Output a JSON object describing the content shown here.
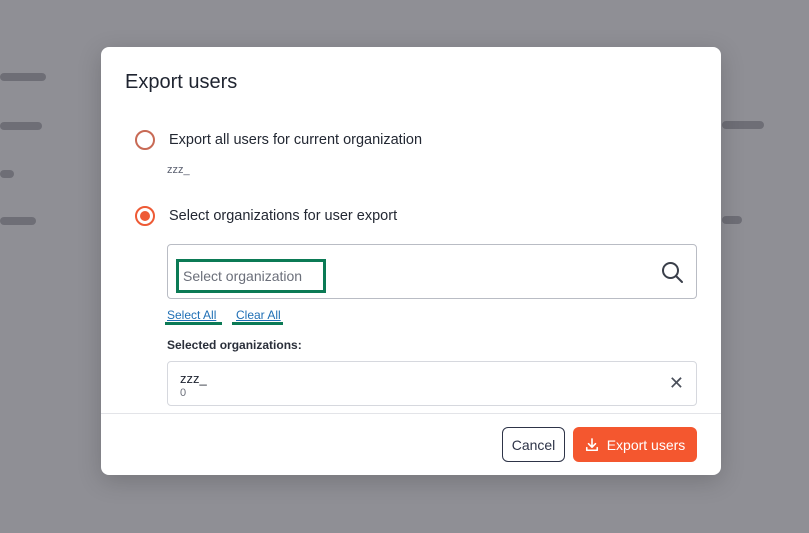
{
  "modal": {
    "title": "Export users",
    "option_all": {
      "label": "Export all users for current organization",
      "org_subtext": "zzz_",
      "checked": false
    },
    "option_select": {
      "label": "Select organizations for user export",
      "checked": true
    },
    "search": {
      "placeholder": "Select organization",
      "icon": "search-icon"
    },
    "links": {
      "select_all": "Select All",
      "clear_all": "Clear All"
    },
    "selected_heading": "Selected organizations:",
    "selected_orgs": [
      {
        "name": "zzz_",
        "id": "0",
        "remove_icon": "close-icon"
      }
    ],
    "buttons": {
      "cancel": "Cancel",
      "export": "Export users",
      "export_icon": "download-icon"
    }
  },
  "colors": {
    "accent": "#f4572f",
    "radio_selected": "#ee5a35",
    "link": "#1f6fb5",
    "highlight": "#0b7a55"
  }
}
